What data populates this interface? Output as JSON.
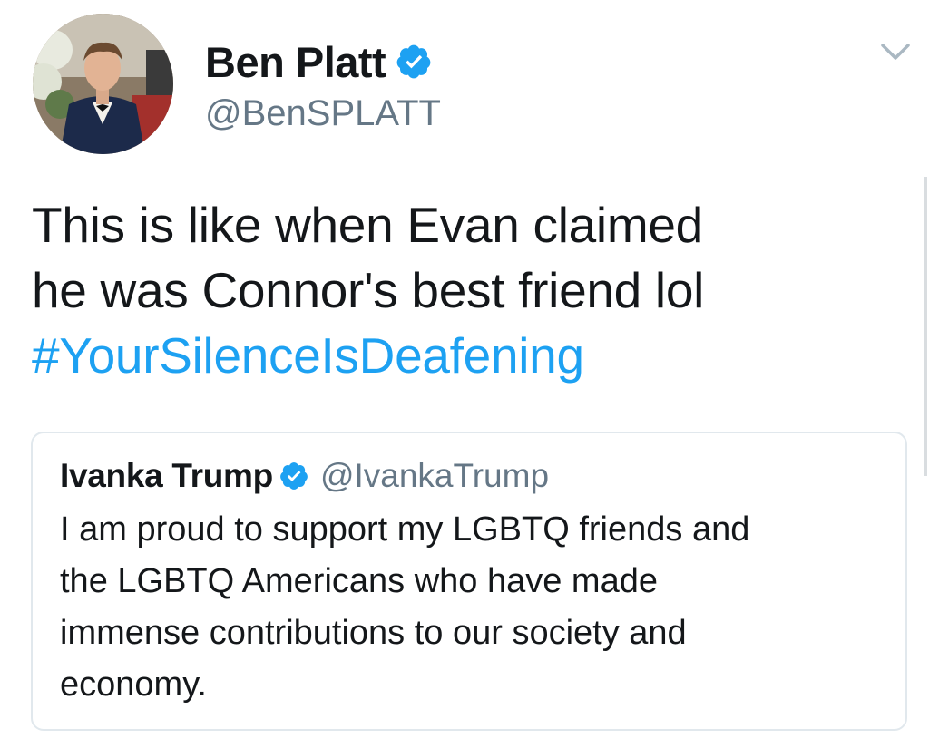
{
  "author": {
    "name": "Ben Platt",
    "handle": "@BenSPLATT",
    "verified": true
  },
  "tweet": {
    "text_lines": [
      "This is like when Evan claimed",
      "he was Connor's best friend lol"
    ],
    "hashtag": "#YourSilenceIsDeafening"
  },
  "quoted_tweet": {
    "name": "Ivanka Trump",
    "handle": "@IvankaTrump",
    "verified": true,
    "text_lines": [
      "I am proud to support my LGBTQ friends and",
      "the LGBTQ Americans who have made",
      "immense contributions to our society and",
      "economy."
    ]
  },
  "icons": {
    "verified": "verified-badge-icon",
    "menu": "chevron-down-icon"
  },
  "colors": {
    "link": "#1da1f2",
    "verified": "#1da1f2",
    "secondary_text": "#657786",
    "border": "#e1e8ed"
  }
}
